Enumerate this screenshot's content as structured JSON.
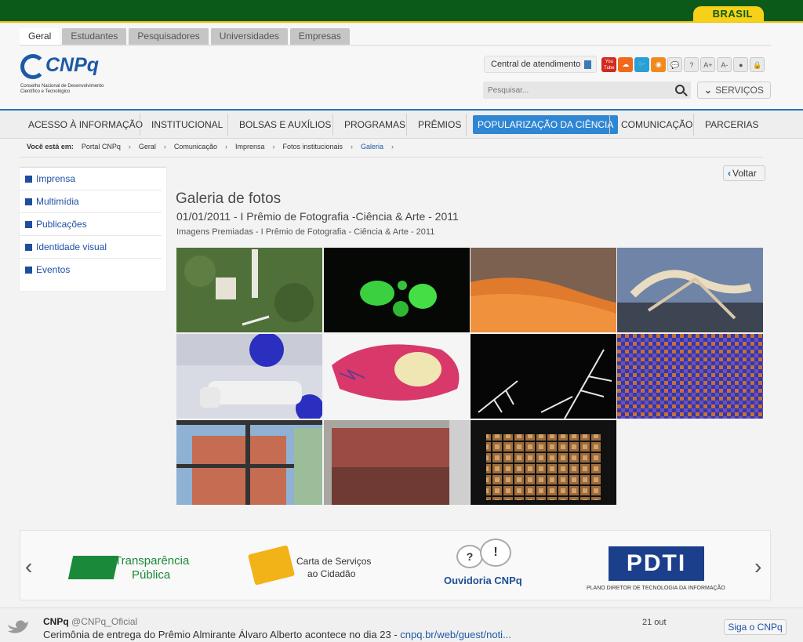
{
  "gov_bar": {
    "brasil_label": "BRASIL"
  },
  "tabs": [
    "Geral",
    "Estudantes",
    "Pesquisadores",
    "Universidades",
    "Empresas"
  ],
  "logo": {
    "name": "CNPq",
    "subtitle": "Conselho Nacional de Desenvolvimento Científico e Tecnológico"
  },
  "utility": {
    "central_label": "Central de atendimento",
    "icons": [
      {
        "name": "youtube-icon",
        "glyph": "You\nTube",
        "color": "#d22a1e"
      },
      {
        "name": "soundcloud-icon",
        "glyph": "☁",
        "color": "#f06a1a"
      },
      {
        "name": "twitter-icon",
        "glyph": "🐦",
        "color": "#2a9fd6"
      },
      {
        "name": "rss-icon",
        "glyph": "◉",
        "color": "#ef8b1e"
      },
      {
        "name": "chat-icon",
        "glyph": "💬",
        "color": "grey"
      },
      {
        "name": "help-icon",
        "glyph": "?",
        "color": "grey"
      },
      {
        "name": "font-increase-icon",
        "glyph": "A+",
        "color": "grey"
      },
      {
        "name": "font-decrease-icon",
        "glyph": "A-",
        "color": "grey"
      },
      {
        "name": "contrast-icon",
        "glyph": "●",
        "color": "grey"
      },
      {
        "name": "lock-icon",
        "glyph": "🔒",
        "color": "grey"
      }
    ]
  },
  "search": {
    "placeholder": "Pesquisar..."
  },
  "services_label": "SERVIÇOS",
  "nav": [
    "ACESSO À INFORMAÇÃO",
    "INSTITUCIONAL",
    "BOLSAS E AUXÍLIOS",
    "PROGRAMAS",
    "PRÊMIOS",
    "POPULARIZAÇÃO DA CIÊNCIA",
    "COMUNICAÇÃO",
    "PARCERIAS"
  ],
  "nav_active_index": 5,
  "breadcrumb": {
    "prefix": "Você está em:",
    "items": [
      "Portal CNPq",
      "Geral",
      "Comunicação",
      "Imprensa",
      "Fotos institucionais",
      "Galeria"
    ]
  },
  "sidebar": [
    "Imprensa",
    "Multimídia",
    "Publicações",
    "Identidade visual",
    "Eventos"
  ],
  "voltar_label": "Voltar",
  "gallery": {
    "title": "Galeria de fotos",
    "date_title": "01/01/2011 - I Prêmio de Fotografia -Ciência & Arte - 2011",
    "subtitle": "Imagens Premiadas - I Prêmio de Fotografia - Ciência & Arte - 2011",
    "photos": [
      {
        "name": "photo-aerial-forest-tower",
        "bg": "#4e6a3c"
      },
      {
        "name": "photo-glowing-mushrooms",
        "bg": "#050805"
      },
      {
        "name": "photo-orange-coral",
        "bg": "#8a5a3a"
      },
      {
        "name": "photo-root-fibers",
        "bg": "#6e7f9a"
      },
      {
        "name": "photo-robot-arm",
        "bg": "#3a4d8a"
      },
      {
        "name": "photo-fish-skull-xray",
        "bg": "#f5f5f5"
      },
      {
        "name": "photo-ice-crystals",
        "bg": "#060606"
      },
      {
        "name": "photo-blue-mosaic",
        "bg": "#3a3c9a"
      },
      {
        "name": "photo-building-reflection",
        "bg": "#7a9cc0"
      },
      {
        "name": "photo-ruined-brick-wall",
        "bg": "#8a5a55"
      },
      {
        "name": "photo-pattern-collage",
        "bg": "#111111"
      }
    ]
  },
  "partners": [
    {
      "name": "transparencia-publica-logo",
      "line1": "Transparência",
      "line2": "Pública"
    },
    {
      "name": "carta-servicos-logo",
      "line1": "Carta de Serviços",
      "line2": "ao Cidadão"
    },
    {
      "name": "ouvidoria-logo",
      "line1": "Ouvidoria CNPq",
      "line2": ""
    },
    {
      "name": "pdti-logo",
      "line1": "PDTI",
      "line2": "PLANO DIRETOR DE TECNOLOGIA DA INFORMAÇÃO"
    }
  ],
  "twitter": {
    "user": "CNPq",
    "handle": "@CNPq_Oficial",
    "text": "Cerimônia de entrega do Prêmio Almirante Álvaro Alberto acontece no dia 23 - ",
    "link": "cnpq.br/web/guest/noti...",
    "date": "21 out",
    "follow_label": "Siga o CNPq"
  }
}
